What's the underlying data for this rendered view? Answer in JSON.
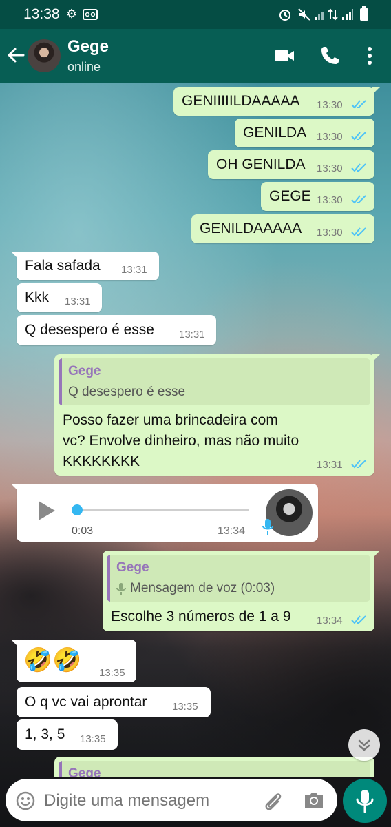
{
  "status_bar": {
    "time": "13:38"
  },
  "header": {
    "name": "Gege",
    "status": "online"
  },
  "messages": [
    {
      "text": "GENIIIIILDAAAAA",
      "time": "13:30"
    },
    {
      "text": "GENILDA",
      "time": "13:30"
    },
    {
      "text": "OH GENILDA",
      "time": "13:30"
    },
    {
      "text": "GEGE",
      "time": "13:30"
    },
    {
      "text": "GENILDAAAAA",
      "time": "13:30"
    },
    {
      "text": "Fala safada",
      "time": "13:31"
    },
    {
      "text": "Kkk",
      "time": "13:31"
    },
    {
      "text": "Q desespero é esse",
      "time": "13:31"
    },
    {
      "quote_name": "Gege",
      "quote_text": "Q desespero é esse",
      "line1": "Posso fazer uma brincadeira com",
      "line2": "vc? Envolve dinheiro, mas não muito",
      "line3": "KKKKKKKK",
      "time": "13:31"
    },
    {
      "duration": "0:03",
      "time": "13:34",
      "progress": 0
    },
    {
      "quote_name": "Gege",
      "quote_text": "Mensagem de voz (0:03)",
      "text": "Escolhe 3 números de 1 a 9",
      "time": "13:34"
    },
    {
      "text": "🤣🤣",
      "time": "13:35"
    },
    {
      "text": "O q vc vai aprontar",
      "time": "13:35"
    },
    {
      "text": "1, 3, 5",
      "time": "13:35"
    },
    {
      "quote_name": "Gege"
    }
  ],
  "input": {
    "placeholder": "Digite uma mensagem"
  },
  "colors": {
    "header": "#075e54",
    "outgoing": "#dcf8c6",
    "incoming": "#ffffff",
    "read_ticks": "#4fc3f7",
    "accent": "#00897b"
  }
}
